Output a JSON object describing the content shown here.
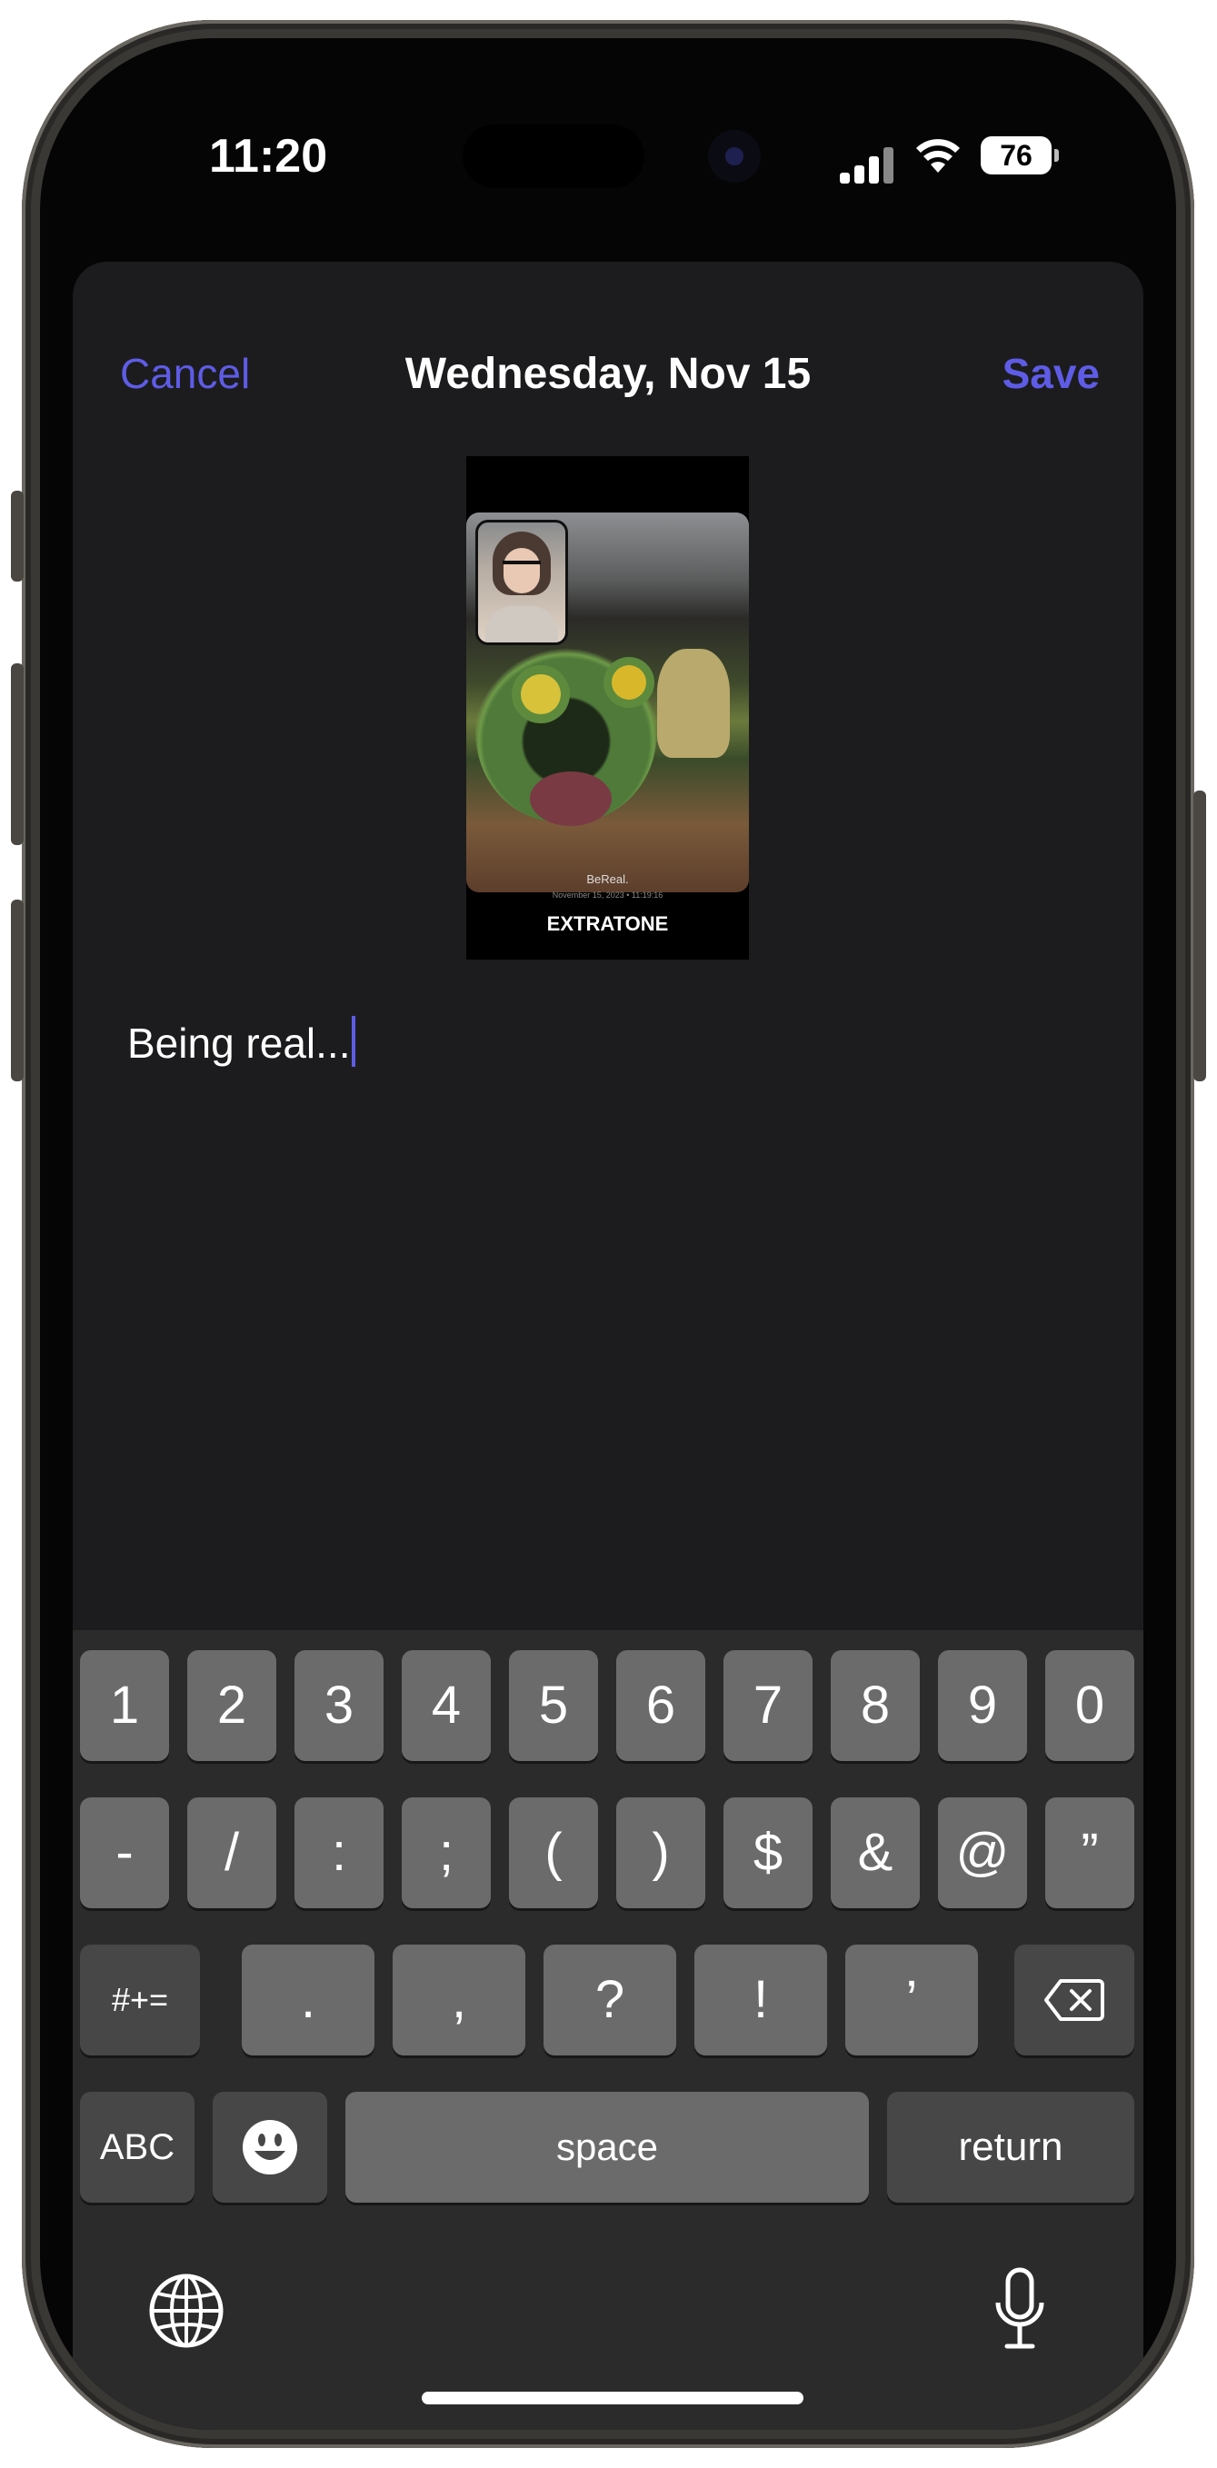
{
  "status_bar": {
    "time": "11:20",
    "battery": "76"
  },
  "nav": {
    "cancel": "Cancel",
    "title": "Wednesday, Nov 15",
    "save": "Save"
  },
  "post": {
    "app_label": "BeReal.",
    "timestamp": "November 15, 2023 • 11:19:16",
    "caption": "EXTRATONE"
  },
  "text_entry": {
    "value": "Being real..."
  },
  "keyboard": {
    "row1": [
      "1",
      "2",
      "3",
      "4",
      "5",
      "6",
      "7",
      "8",
      "9",
      "0"
    ],
    "row2": [
      "-",
      "/",
      ":",
      ";",
      "(",
      ")",
      "$",
      "&",
      "@",
      "”"
    ],
    "row3_mode": "#+=",
    "row3": [
      ".",
      ",",
      "?",
      "!",
      "’"
    ],
    "abc": "ABC",
    "space": "space",
    "return": "return"
  },
  "icons": {
    "delete": "delete-backspace-icon",
    "emoji": "emoji-icon",
    "globe": "globe-icon",
    "mic": "microphone-icon"
  }
}
